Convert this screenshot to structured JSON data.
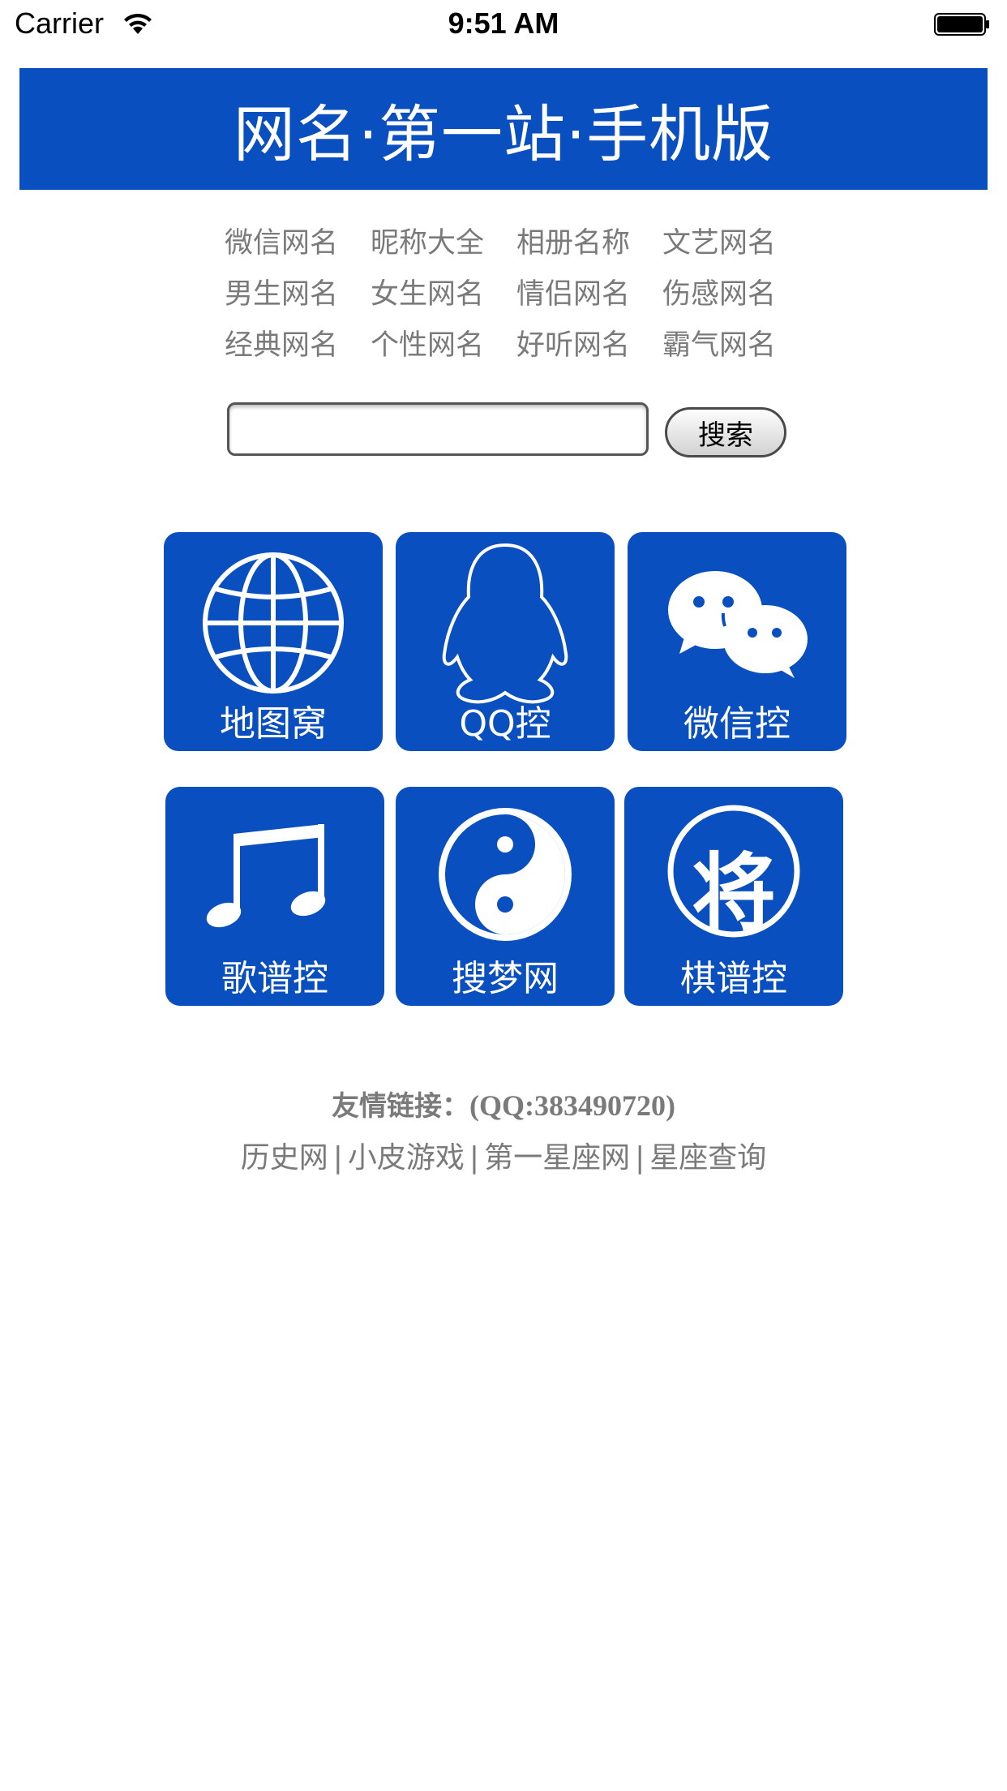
{
  "status_bar": {
    "carrier": "Carrier",
    "time": "9:51 AM"
  },
  "header": {
    "title": "网名·第一站·手机版"
  },
  "categories": [
    "微信网名",
    "昵称大全",
    "相册名称",
    "文艺网名",
    "男生网名",
    "女生网名",
    "情侣网名",
    "伤感网名",
    "经典网名",
    "个性网名",
    "好听网名",
    "霸气网名"
  ],
  "search": {
    "placeholder": "",
    "button_label": "搜索"
  },
  "tiles": [
    {
      "label": "地图窝",
      "icon": "globe-icon"
    },
    {
      "label": "QQ控",
      "icon": "penguin-icon"
    },
    {
      "label": "微信控",
      "icon": "wechat-icon"
    },
    {
      "label": "歌谱控",
      "icon": "music-note-icon"
    },
    {
      "label": "搜梦网",
      "icon": "yin-yang-icon"
    },
    {
      "label": "棋谱控",
      "icon": "chess-piece-icon",
      "icon_char": "将"
    }
  ],
  "footer": {
    "friend_label": "友情链接：",
    "qq": "(QQ:383490720)",
    "links": [
      "历史网",
      "小皮游戏",
      "第一星座网",
      "星座查询"
    ],
    "separator": "|"
  },
  "colors": {
    "brand_blue": "#0a4fbf",
    "text_gray": "#7a7a7a"
  }
}
